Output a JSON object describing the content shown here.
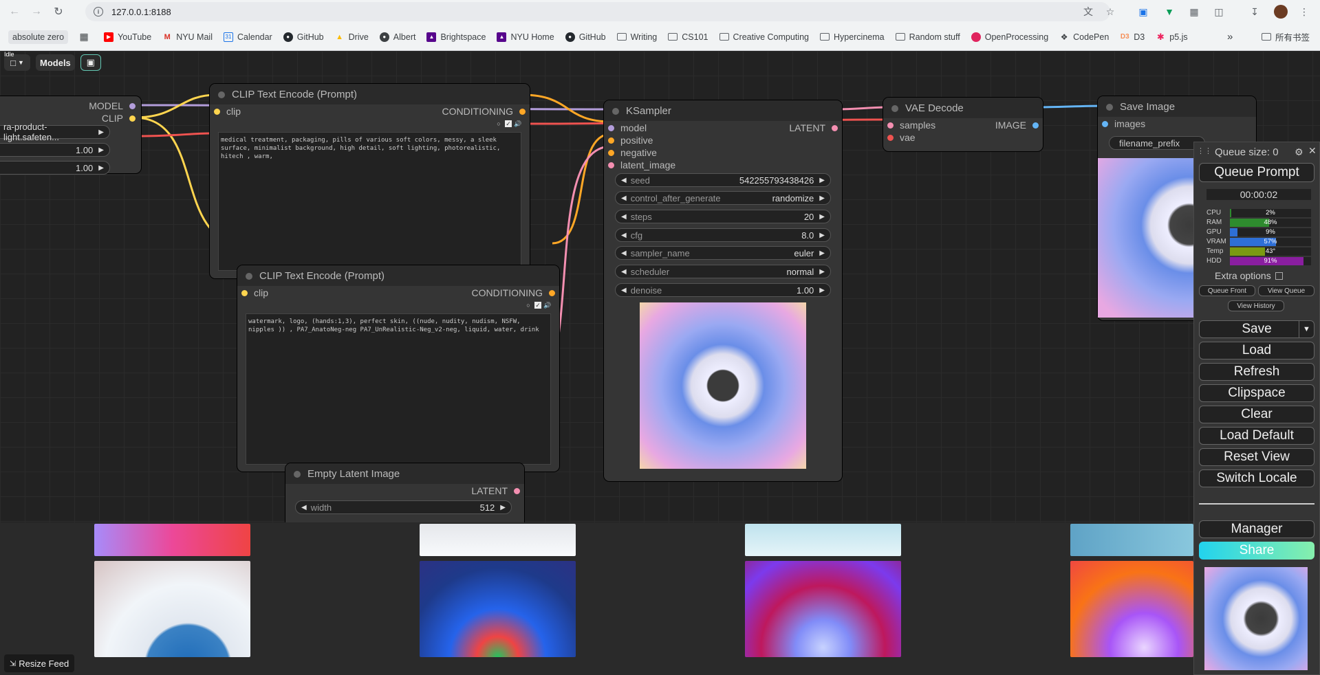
{
  "browser": {
    "url": "127.0.0.1:8188",
    "bookmarks": [
      {
        "label": "absolute zero",
        "icon": "profile-box"
      },
      {
        "label": "",
        "icon": "apps-grid-icon"
      },
      {
        "label": "YouTube",
        "icon": "youtube-icon"
      },
      {
        "label": "NYU Mail",
        "icon": "gmail-icon"
      },
      {
        "label": "Calendar",
        "icon": "calendar-icon"
      },
      {
        "label": "GitHub",
        "icon": "github-icon"
      },
      {
        "label": "Drive",
        "icon": "drive-icon"
      },
      {
        "label": "Albert",
        "icon": "globe-icon"
      },
      {
        "label": "Brightspace",
        "icon": "nyu-icon"
      },
      {
        "label": "NYU Home",
        "icon": "nyu-icon"
      },
      {
        "label": "GitHub",
        "icon": "github-icon"
      },
      {
        "label": "Writing",
        "icon": "folder-icon"
      },
      {
        "label": "CS101",
        "icon": "folder-icon"
      },
      {
        "label": "Creative Computing",
        "icon": "folder-icon"
      },
      {
        "label": "Hypercinema",
        "icon": "folder-icon"
      },
      {
        "label": "Random stuff",
        "icon": "folder-icon"
      },
      {
        "label": "OpenProcessing",
        "icon": "openprocessing-icon"
      },
      {
        "label": "CodePen",
        "icon": "codepen-icon"
      },
      {
        "label": "D3",
        "icon": "d3-icon"
      },
      {
        "label": "p5.js",
        "icon": "p5-icon"
      }
    ],
    "more_label": "»",
    "all_bookmarks": "所有书签"
  },
  "toolbar": {
    "status": "Idle",
    "models_label": "Models"
  },
  "nodes": {
    "checkpoint": {
      "outputs": {
        "model": "MODEL",
        "clip": "CLIP"
      },
      "ckpt_name": "ra-product-light.safeten...",
      "w1": "1.00",
      "w2": "1.00"
    },
    "clip_pos": {
      "title": "CLIP Text Encode (Prompt)",
      "input": "clip",
      "output": "CONDITIONING",
      "text": "medical treatment, packaging, pills of various soft colors, messy, a sleek\nsurface, minimalist background, high detail, soft lighting, photorealistic,\nhitech , warm,"
    },
    "clip_neg": {
      "title": "CLIP Text Encode (Prompt)",
      "input": "clip",
      "output": "CONDITIONING",
      "text": "watermark, logo, (hands:1,3), perfect skin, ((nude, nudity, nudism, NSFW,\nnipples )) , PA7_AnatoNeg-neg PA7_UnRealistic-Neg_v2-neg, liquid, water, drink"
    },
    "empty_latent": {
      "title": "Empty Latent Image",
      "output": "LATENT",
      "width_label": "width",
      "width_value": "512"
    },
    "ksampler": {
      "title": "KSampler",
      "inputs": [
        "model",
        "positive",
        "negative",
        "latent_image"
      ],
      "output": "LATENT",
      "widgets": [
        {
          "label": "seed",
          "value": "542255793438426"
        },
        {
          "label": "control_after_generate",
          "value": "randomize"
        },
        {
          "label": "steps",
          "value": "20"
        },
        {
          "label": "cfg",
          "value": "8.0"
        },
        {
          "label": "sampler_name",
          "value": "euler"
        },
        {
          "label": "scheduler",
          "value": "normal"
        },
        {
          "label": "denoise",
          "value": "1.00"
        }
      ]
    },
    "vae_decode": {
      "title": "VAE Decode",
      "inputs": [
        "samples",
        "vae"
      ],
      "output": "IMAGE"
    },
    "save_image": {
      "title": "Save Image",
      "input": "images",
      "widget": "filename_prefix"
    }
  },
  "queue": {
    "size_label": "Queue size: 0",
    "queue_prompt": "Queue Prompt",
    "timer": "00:00:02",
    "stats": [
      {
        "name": "CPU",
        "pct": "2%",
        "value": 2,
        "color": "#2e8b2e"
      },
      {
        "name": "RAM",
        "pct": "48%",
        "value": 48,
        "color": "#2e8b2e"
      },
      {
        "name": "GPU",
        "pct": "9%",
        "value": 9,
        "color": "#2e6fd6"
      },
      {
        "name": "VRAM",
        "pct": "57%",
        "value": 57,
        "color": "#2e6fd6"
      },
      {
        "name": "Temp",
        "pct": "43°",
        "value": 43,
        "color": "#7a9a12"
      },
      {
        "name": "HDD",
        "pct": "91%",
        "value": 91,
        "color": "#8a1ea0"
      }
    ],
    "extra_options": "Extra options",
    "queue_front": "Queue Front",
    "view_queue": "View Queue",
    "view_history": "View History",
    "buttons": [
      "Save",
      "Load",
      "Refresh",
      "Clipspace",
      "Clear",
      "Load Default",
      "Reset View",
      "Switch Locale"
    ],
    "manager": "Manager",
    "share": "Share"
  },
  "feed": {
    "resize_label": "Resize Feed"
  }
}
